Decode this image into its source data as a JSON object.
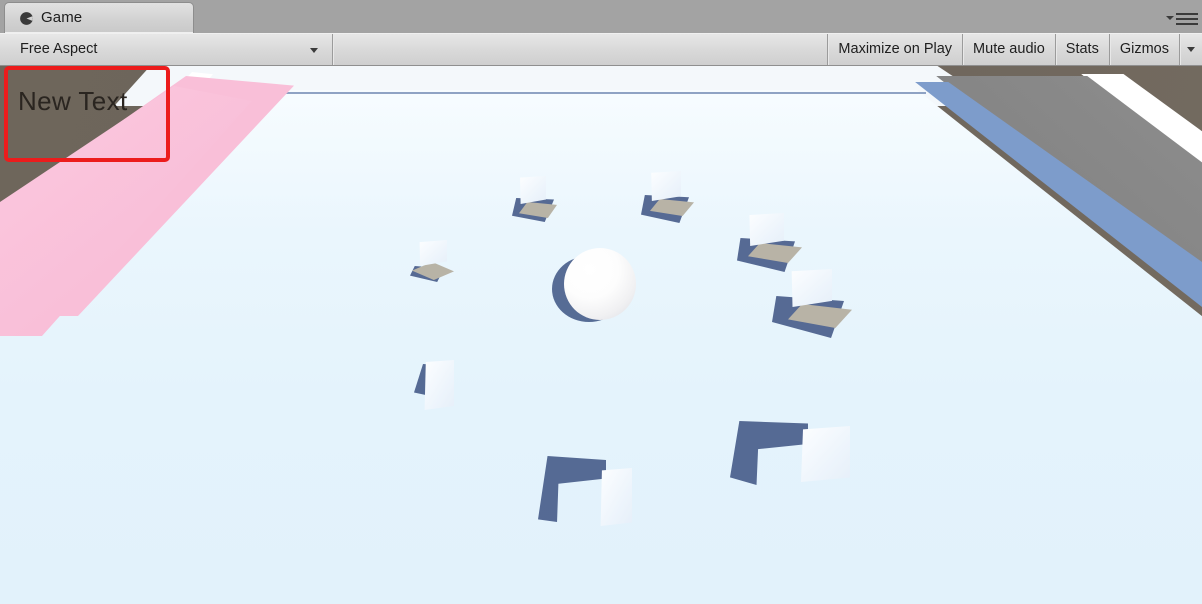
{
  "window": {
    "tab": {
      "label": "Game",
      "icon": "unity-game-view-icon"
    },
    "panel_menu_icon": "hamburger-menu-icon",
    "panel_menu_caret_icon": "chevron-down-icon"
  },
  "toolbar": {
    "aspect": {
      "label": "Free Aspect",
      "caret_icon": "chevron-down-icon",
      "options": [
        "Free Aspect"
      ]
    },
    "maximize_on_play_label": "Maximize on Play",
    "mute_audio_label": "Mute audio",
    "stats_label": "Stats",
    "gizmos_label": "Gizmos",
    "gizmos_caret_icon": "chevron-down-icon"
  },
  "game_view": {
    "ui_overlay": {
      "text": "New Text",
      "highlight": {
        "shape": "rectangle",
        "color": "#ec1c1c"
      }
    },
    "scene": {
      "floor_color": "#e4f3fc",
      "backdrop_color": "#6e665b",
      "horizon_color": "#8fa3c4",
      "left_wall_color": "#f9bfd8",
      "right_wall_top_color": "#7d9ccb",
      "right_wall_face_color": "#8a8a8a",
      "shadow_color": "#4a5f8c",
      "cube_face_color": "#eef5fc",
      "cube_top_color": "#b8b3a6",
      "sphere_color": "#ffffff"
    }
  }
}
